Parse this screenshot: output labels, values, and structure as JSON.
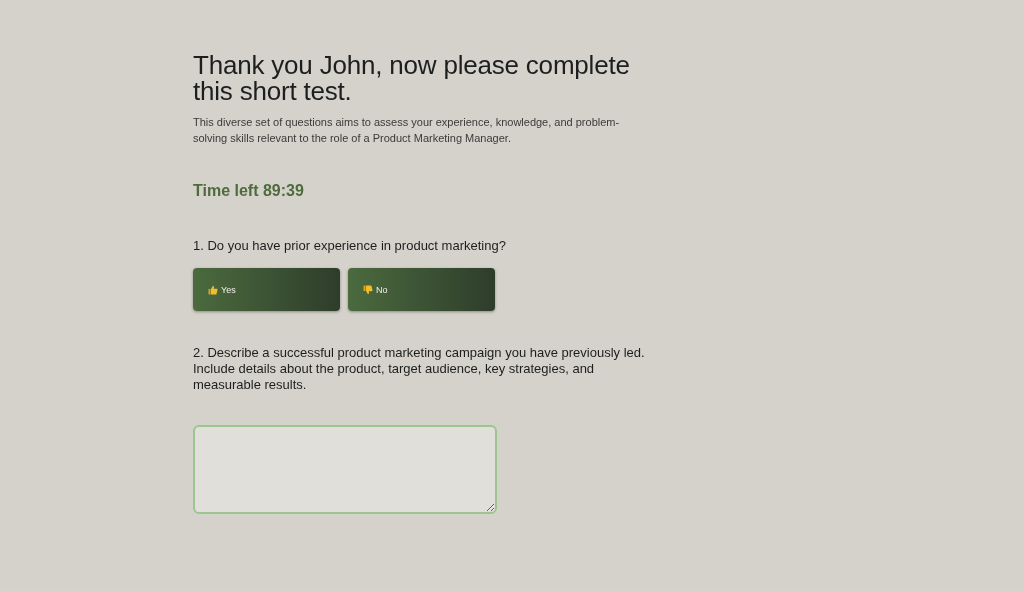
{
  "heading": "Thank you John, now please complete this short test.",
  "intro": "This diverse set of questions aims to assess your experience, knowledge, and problem-solving skills relevant to the role of a Product Marketing Manager.",
  "timer": "Time left 89:39",
  "questions": [
    {
      "kind": "choice",
      "text": "1. Do you have prior experience in product marketing?",
      "options": [
        {
          "kind": "thumb-up",
          "label": "Yes"
        },
        {
          "kind": "thumb-down",
          "label": "No"
        }
      ]
    },
    {
      "kind": "text",
      "text": "2. Describe a successful product marketing campaign you have previously led. Include details about the product, target audience, key strategies, and measurable results."
    }
  ]
}
